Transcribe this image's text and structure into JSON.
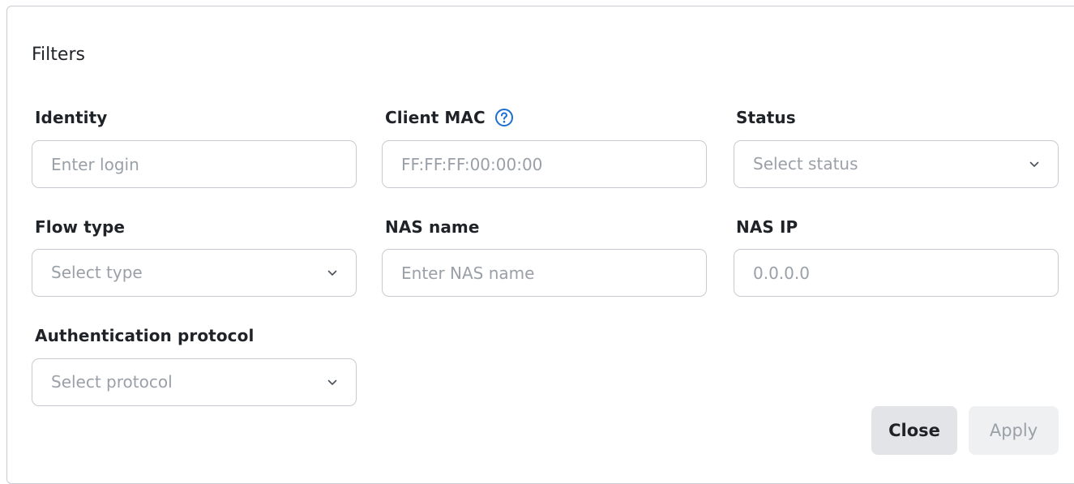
{
  "dialog": {
    "title": "Filters"
  },
  "filters": {
    "identity": {
      "label": "Identity",
      "placeholder": "Enter login"
    },
    "client_mac": {
      "label": "Client MAC",
      "placeholder": "FF:FF:FF:00:00:00",
      "icon": "help-circle-icon"
    },
    "status": {
      "label": "Status",
      "placeholder": "Select status"
    },
    "flow_type": {
      "label": "Flow type",
      "placeholder": "Select type"
    },
    "nas_name": {
      "label": "NAS name",
      "placeholder": "Enter NAS name"
    },
    "nas_ip": {
      "label": "NAS IP",
      "placeholder": "0.0.0.0"
    },
    "auth_protocol": {
      "label": "Authentication protocol",
      "placeholder": "Select protocol"
    }
  },
  "actions": {
    "close_label": "Close",
    "apply_label": "Apply"
  },
  "colors": {
    "border": "#c7cbd1",
    "placeholder": "#9aa0a8",
    "accent": "#1a6fd1",
    "close_bg": "#e2e4e7",
    "apply_bg_disabled": "#eef0f2"
  }
}
